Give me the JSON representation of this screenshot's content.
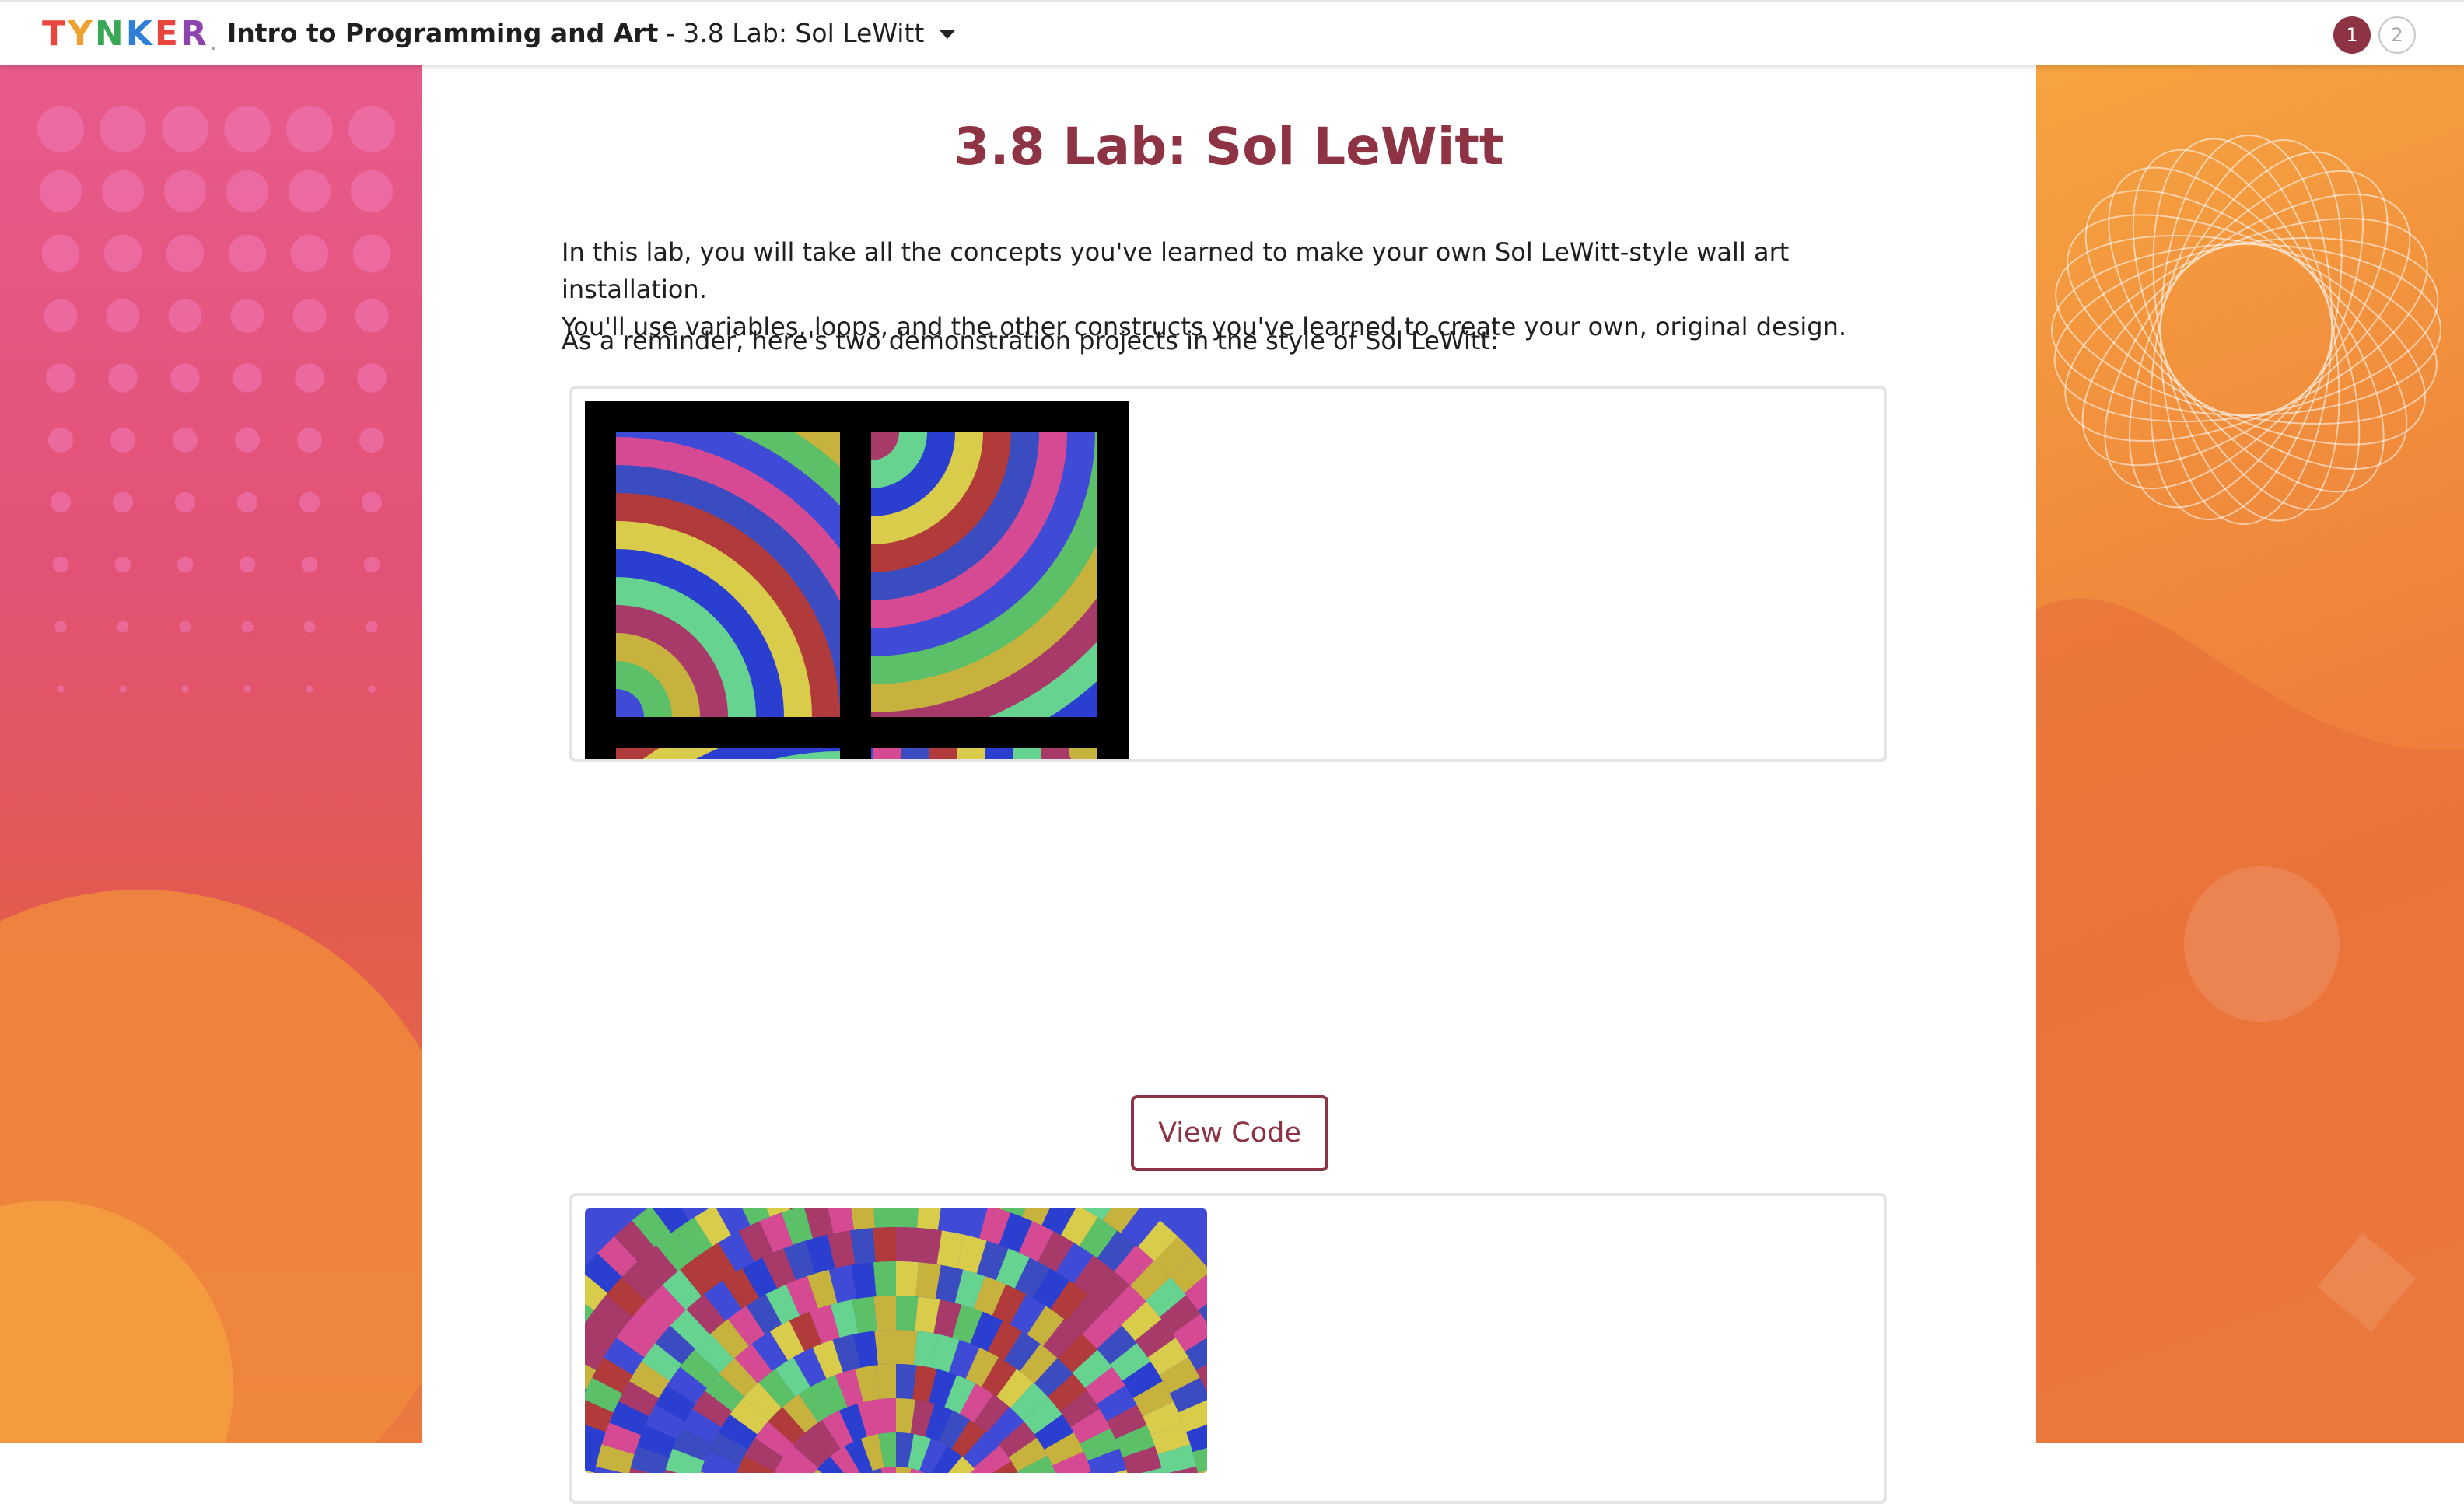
{
  "header": {
    "logo": [
      "T",
      "Y",
      "N",
      "K",
      "E",
      "R"
    ],
    "logo_suffix": ".",
    "course_title": "Intro to Programming and Art",
    "separator": "-",
    "lesson_title": "3.8 Lab: Sol LeWitt",
    "pages": [
      "1",
      "2"
    ],
    "active_page": "1"
  },
  "content": {
    "title": "3.8 Lab: Sol LeWitt",
    "intro_line1": "In this lab, you will take all the concepts you've learned to make your own Sol LeWitt-style wall art installation.",
    "intro_line2": "You'll use variables, loops, and the other constructs you've learned to create your own, original design.",
    "reminder": "As a reminder, here's two demonstration projects in the style of Sol LeWitt:",
    "view_code_label": "View Code"
  },
  "colors": {
    "accent": "#8e3344",
    "art_palette": [
      "#d64a93",
      "#3f4ad6",
      "#5cc068",
      "#c8b23e",
      "#a83a6a",
      "#66d490",
      "#2a3fd0",
      "#d8cc4a",
      "#b13a3a",
      "#3b4cc0"
    ]
  },
  "icons": {
    "caret": "chevron-down-icon"
  }
}
